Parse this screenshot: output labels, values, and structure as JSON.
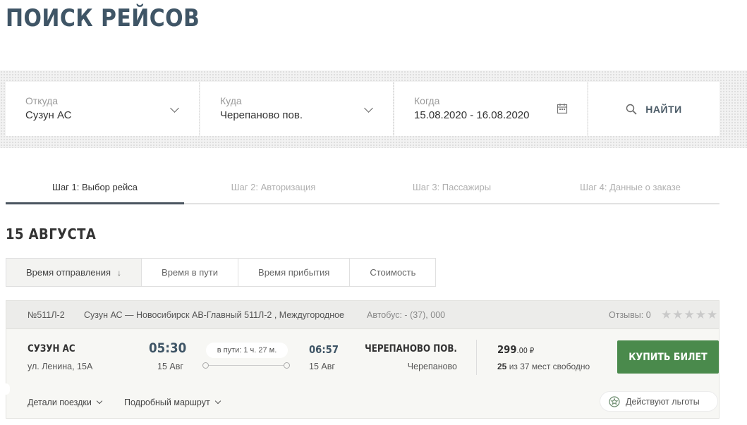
{
  "page_title": "ПОИСК РЕЙСОВ",
  "search": {
    "from": {
      "label": "Откуда",
      "value": "Сузун АС"
    },
    "to": {
      "label": "Куда",
      "value": "Черепаново пов."
    },
    "when": {
      "label": "Когда",
      "value": "15.08.2020 - 16.08.2020"
    },
    "button_label": "НАЙТИ"
  },
  "steps": [
    {
      "label": "Шаг 1: Выбор рейса",
      "active": true
    },
    {
      "label": "Шаг 2: Авторизация",
      "active": false
    },
    {
      "label": "Шаг 3: Пассажиры",
      "active": false
    },
    {
      "label": "Шаг 4: Данные о заказе",
      "active": false
    }
  ],
  "date_heading": "15 АВГУСТА",
  "sort": {
    "items": [
      "Время отправления",
      "Время в пути",
      "Время прибытия",
      "Стоимость"
    ],
    "active_arrow": "↓"
  },
  "trip": {
    "number": "№511Л-2",
    "route_name": "Сузун АС — Новосибирск АВ-Главный 511Л-2 , Междугородное",
    "bus": "Автобус: - (37), 000",
    "reviews_label": "Отзывы: 0",
    "rating": 0,
    "departure": {
      "station": "СУЗУН АС",
      "address": "ул. Ленина, 15А",
      "time": "05:30",
      "date": "15 Авг"
    },
    "duration": "в пути: 1 ч. 27 м.",
    "arrival": {
      "time": "06:57",
      "date": "15 Авг",
      "station": "ЧЕРЕПАНОВО ПОВ.",
      "city": "Черепаново"
    },
    "price": {
      "main": "299",
      "cents": ".00 ₽"
    },
    "seats": {
      "free": "25",
      "text": "из 37 мест свободно"
    },
    "buy_label": "КУПИТЬ БИЛЕТ",
    "details_label": "Детали поездки",
    "route_label": "Подробный маршрут",
    "benefits_label": "Действуют льготы"
  },
  "colors": {
    "title": "#3f5566",
    "buy_button": "#4a8a4c",
    "active_step": "#4b5560"
  }
}
